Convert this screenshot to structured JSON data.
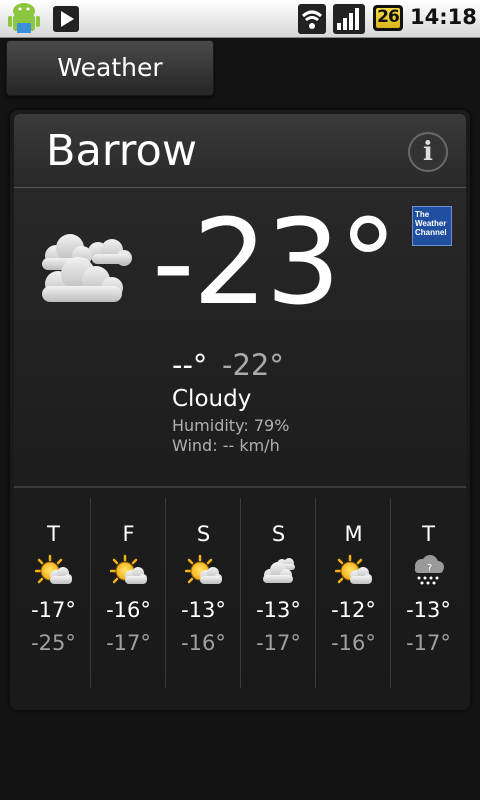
{
  "status_bar": {
    "icons": [
      "android-app-icon",
      "play-store-icon",
      "wifi-icon",
      "signal-icon",
      "battery-icon"
    ],
    "battery_level": "26",
    "clock": "14:18"
  },
  "tab": {
    "label": "Weather"
  },
  "location": {
    "city": "Barrow"
  },
  "current": {
    "temperature": "-23°",
    "high": "--°",
    "low": "-22°",
    "condition": "Cloudy",
    "humidity": "Humidity: 79%",
    "wind": "Wind: -- km/h",
    "icon": "cloudy-icon"
  },
  "provider": {
    "logo_text": [
      "The",
      "Weather",
      "Channel"
    ],
    "color": "#1f4f9e"
  },
  "forecast": [
    {
      "day": "T",
      "hi": "-17°",
      "lo": "-25°",
      "icon": "partly-sunny-icon"
    },
    {
      "day": "F",
      "hi": "-16°",
      "lo": "-17°",
      "icon": "partly-sunny-icon"
    },
    {
      "day": "S",
      "hi": "-13°",
      "lo": "-16°",
      "icon": "partly-sunny-icon"
    },
    {
      "day": "S",
      "hi": "-13°",
      "lo": "-17°",
      "icon": "cloudy-icon"
    },
    {
      "day": "M",
      "hi": "-12°",
      "lo": "-16°",
      "icon": "partly-sunny-icon"
    },
    {
      "day": "T",
      "hi": "-13°",
      "lo": "-17°",
      "icon": "snow-shower-icon"
    }
  ]
}
